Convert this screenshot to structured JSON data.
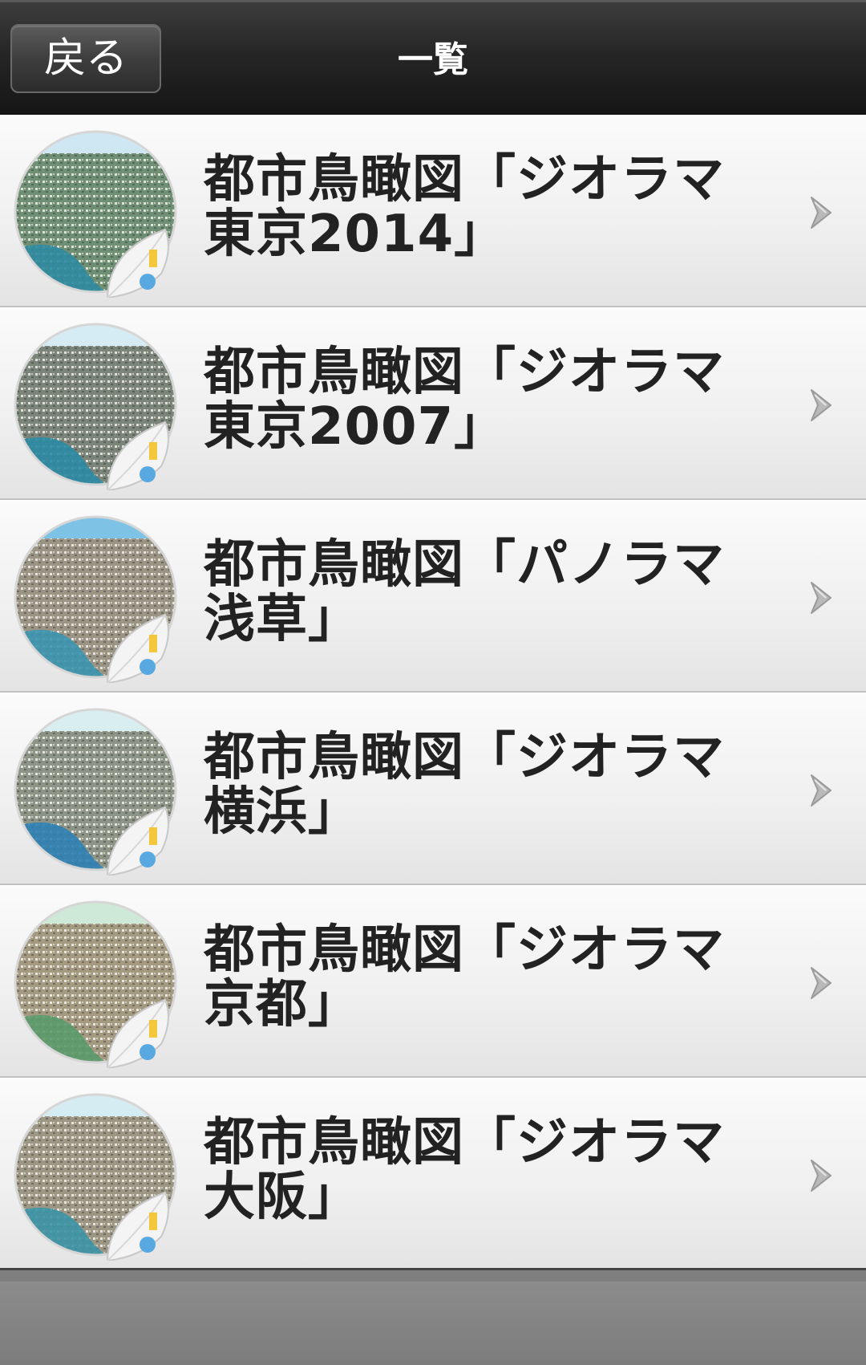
{
  "header": {
    "back_label": "戻る",
    "title": "一覧"
  },
  "list": {
    "items": [
      {
        "label": "都市鳥瞰図「ジオラマ東京2014」",
        "thumb_sky": "#cfe7f3",
        "thumb_water": "#2f8aa0",
        "thumb_land": "#6f8f74"
      },
      {
        "label": "都市鳥瞰図「ジオラマ東京2007」",
        "thumb_sky": "#d6ecf5",
        "thumb_water": "#2b8aa3",
        "thumb_land": "#7a8478"
      },
      {
        "label": "都市鳥瞰図「パノラマ浅草」",
        "thumb_sky": "#7ec3e6",
        "thumb_water": "#3b93b0",
        "thumb_land": "#9a9484"
      },
      {
        "label": "都市鳥瞰図「ジオラマ横浜」",
        "thumb_sky": "#d8eef0",
        "thumb_water": "#2e7fb4",
        "thumb_land": "#8d9486"
      },
      {
        "label": "都市鳥瞰図「ジオラマ京都」",
        "thumb_sky": "#cfe9d8",
        "thumb_water": "#5a9a6a",
        "thumb_land": "#a49a82"
      },
      {
        "label": "都市鳥瞰図「ジオラマ大阪」",
        "thumb_sky": "#d5ecf2",
        "thumb_water": "#3c94a6",
        "thumb_land": "#9c9684"
      }
    ]
  }
}
